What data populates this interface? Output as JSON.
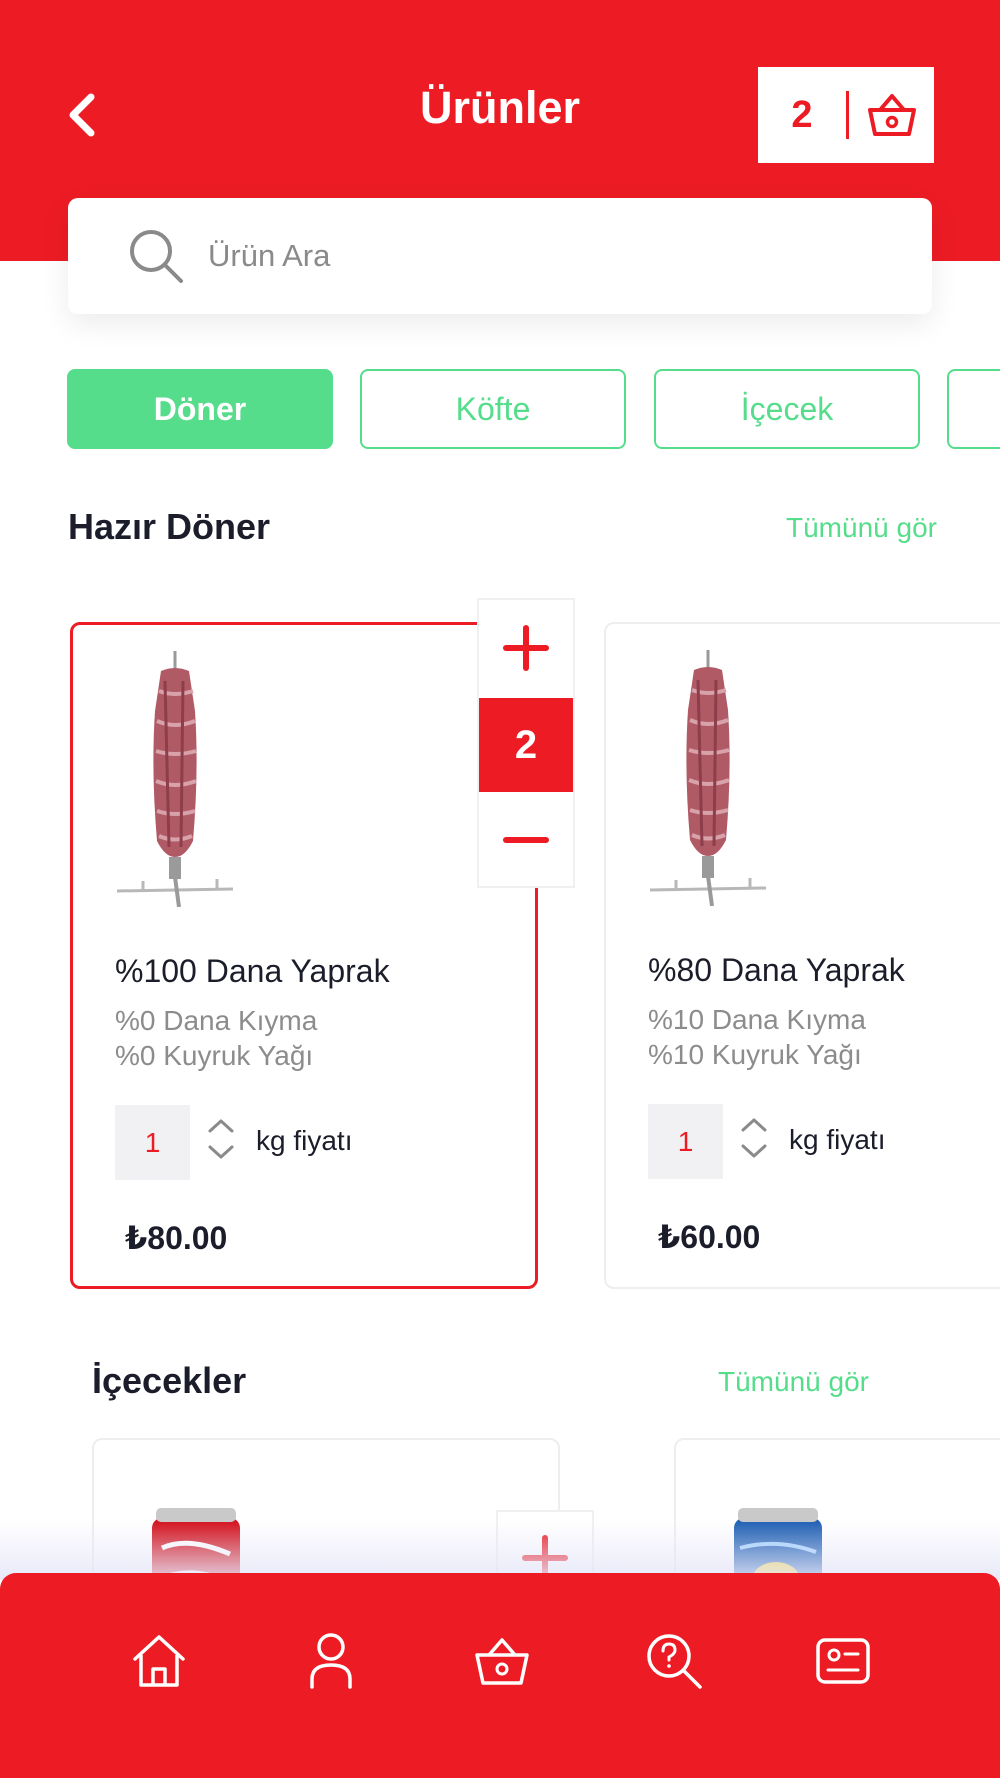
{
  "header": {
    "title": "Ürünler",
    "cart_count": "2"
  },
  "search": {
    "placeholder": "Ürün Ara"
  },
  "categories": [
    {
      "label": "Döner",
      "active": true
    },
    {
      "label": "Köfte",
      "active": false
    },
    {
      "label": "İçecek",
      "active": false
    }
  ],
  "section_doner": {
    "title": "Hazır Döner",
    "see_all": "Tümünü gör",
    "products": [
      {
        "name": "%100 Dana Yaprak",
        "desc1": "%0 Dana Kıyma",
        "desc2": "%0 Kuyruk Yağı",
        "quantity": "1",
        "unit": "kg fiyatı",
        "price": "₺80.00",
        "cart_count": "2"
      },
      {
        "name": "%80 Dana Yaprak",
        "desc1": "%10 Dana Kıyma",
        "desc2": "%10 Kuyruk Yağı",
        "quantity": "1",
        "unit": "kg fiyatı",
        "price": "₺60.00"
      }
    ]
  },
  "section_drinks": {
    "title": "İçecekler",
    "see_all": "Tümünü gör"
  },
  "colors": {
    "brand_red": "#ed1c24",
    "accent_green": "#56dd8c"
  },
  "icons": {
    "back": "chevron-left-icon",
    "cart": "basket-icon",
    "search": "search-icon",
    "plus": "plus-icon",
    "minus": "minus-icon",
    "nav": [
      "home-icon",
      "user-icon",
      "basket-icon",
      "help-search-icon",
      "profile-card-icon"
    ]
  }
}
